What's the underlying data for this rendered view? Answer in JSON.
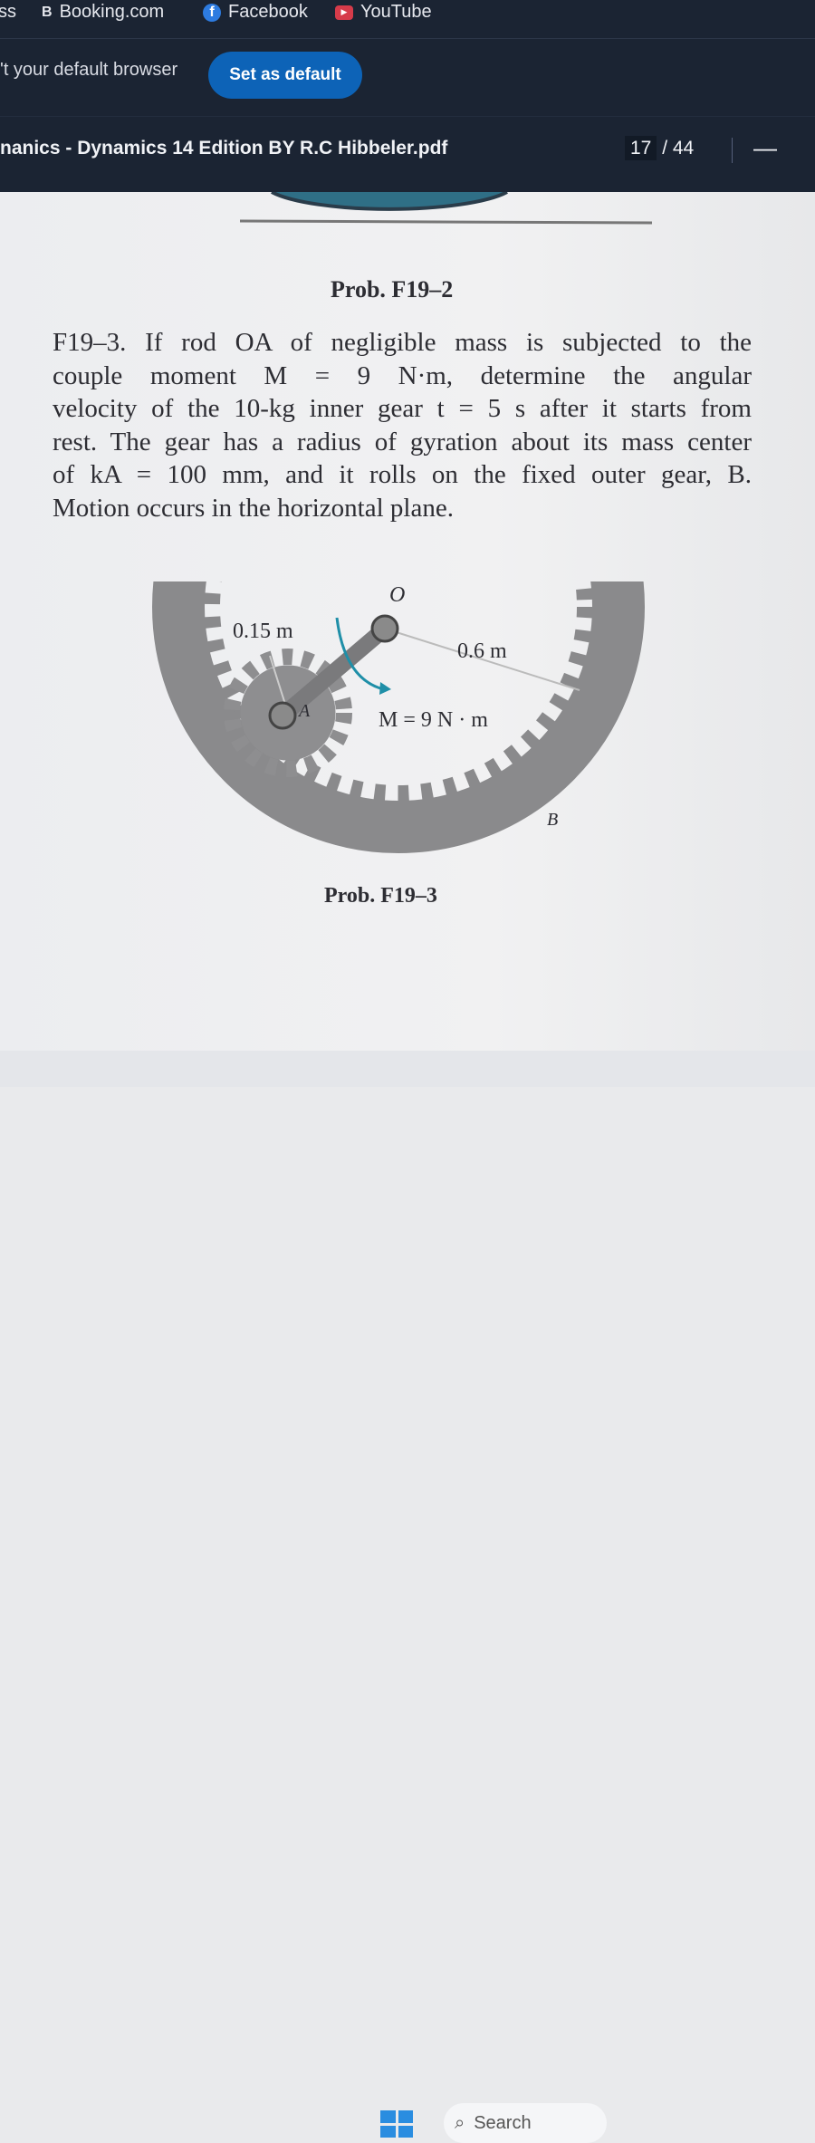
{
  "bookmarks": [
    {
      "label": "ss",
      "icon": "truncated"
    },
    {
      "label": "Booking.com",
      "icon": "booking-icon"
    },
    {
      "label": "Facebook",
      "icon": "facebook-icon"
    },
    {
      "label": "YouTube",
      "icon": "youtube-icon"
    }
  ],
  "default_banner": {
    "text": "'t your default browser",
    "button": "Set as default"
  },
  "pdf_toolbar": {
    "title": "nanics - Dynamics 14 Edition BY R.C Hibbeler.pdf",
    "current_page": "17",
    "total_pages": "/ 44",
    "zoom_out": "—"
  },
  "document": {
    "prev_caption": "Prob. F19–2",
    "problem_lines": [
      "F19–3.  If rod OA of negligible mass is subjected to the",
      "couple moment M = 9 N·m, determine the angular",
      "velocity of the 10-kg inner gear t = 5 s after it starts from",
      "rest. The gear has a radius of gyration about its mass center",
      "of kA = 100 mm, and it rolls on the fixed outer gear, B.",
      "Motion occurs in the horizontal plane."
    ],
    "figure": {
      "label_O": "O",
      "label_A": "A",
      "label_B": "B",
      "dim_inner": "0.15 m",
      "dim_outer": "0.6 m",
      "moment": "M = 9 N · m",
      "moment_arrow_color": "#1f8fa8"
    },
    "caption": "Prob. F19–3"
  },
  "taskbar": {
    "search": "Search"
  }
}
